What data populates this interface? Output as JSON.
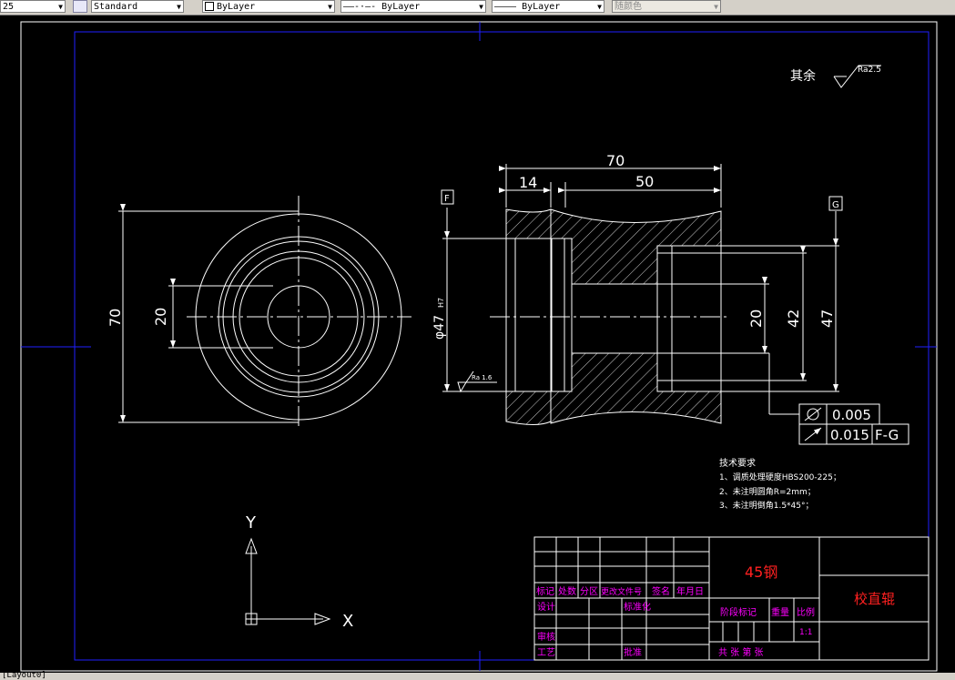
{
  "toolbar": {
    "scale_value": "25",
    "text_style": "Standard",
    "layer": "ByLayer",
    "linetype": "ByLayer",
    "lineweight": "ByLayer",
    "color": "随颜色"
  },
  "command_line": "[Layout0]",
  "drawing": {
    "roughness_other": "其余",
    "roughness_value": "Ra2.5",
    "datum_f": "F",
    "datum_g": "G",
    "dim_70_top": "70",
    "dim_14": "14",
    "dim_50": "50",
    "dim_70_left": "70",
    "dim_20_left": "20",
    "dim_47_bore": "φ47",
    "dim_47_note": "H7",
    "dim_20_right": "20",
    "dim_42": "42",
    "dim_47_right": "47",
    "roughness_bore": "Ra 1.6",
    "tol_flatness": "0.005",
    "tol_runout": "0.015",
    "tol_runout_ref": "F-G",
    "tech_title": "技术要求",
    "tech_1": "1、调质处理硬度HBS200-225；",
    "tech_2": "2、未注明圆角R=2mm；",
    "tech_3": "3、未注明倒角1.5*45°；",
    "ucs_y": "Y",
    "ucs_x": "X"
  },
  "title_block": {
    "material": "45钢",
    "part_name": "校直辊",
    "marks": "标记",
    "count": "处数",
    "zone": "分区",
    "change_doc": "更改文件号",
    "sign": "签名",
    "date": "年月日",
    "design": "设计",
    "standardize": "标准化",
    "stage_mark": "阶段标记",
    "weight": "重量",
    "ratio": "比例",
    "ratio_value": "1:1",
    "review": "审核",
    "process": "工艺",
    "approve": "批准",
    "sheets": "共  张 第  张"
  },
  "colors": {
    "background": "#000000",
    "lines": "#ffffff",
    "border": "#2020ff",
    "title_text": "#ff00ff",
    "red_text": "#ff2020"
  }
}
